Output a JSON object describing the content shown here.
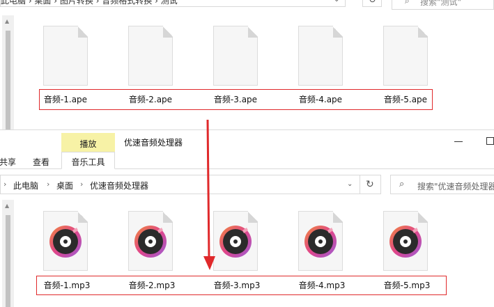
{
  "top_window": {
    "address_path": "此电脑 › 桌面 › 图片转换 › 音频格式转换 › 测试",
    "search_placeholder": "搜索\"测试\"",
    "files": [
      "音频-1.ape",
      "音频-2.ape",
      "音频-3.ape",
      "音频-4.ape",
      "音频-5.ape"
    ]
  },
  "front_window": {
    "title": "优速音频处理器",
    "context_tab": "播放",
    "ribbon_tabs": {
      "share": "共享",
      "view": "查看",
      "music_tools": "音乐工具"
    },
    "breadcrumb": [
      "此电脑",
      "桌面",
      "优速音频处理器"
    ],
    "search_placeholder": "搜索\"优速音频处理器\"",
    "files": [
      "音频-1.mp3",
      "音频-2.mp3",
      "音频-3.mp3",
      "音频-4.mp3",
      "音频-5.mp3"
    ]
  },
  "colors": {
    "highlight_box": "#e0292b",
    "arrow": "#e0292b",
    "context_tab_bg": "#f7f2a6",
    "disc_gradient": [
      "#f0883c",
      "#e0468a",
      "#9b5cd6"
    ]
  },
  "icons": {
    "nav_separator": "chevron-right-icon",
    "refresh": "refresh-icon",
    "search": "search-icon",
    "dropdown": "chevron-down-icon",
    "file_generic": "document-icon",
    "file_audio": "music-disc-icon"
  }
}
